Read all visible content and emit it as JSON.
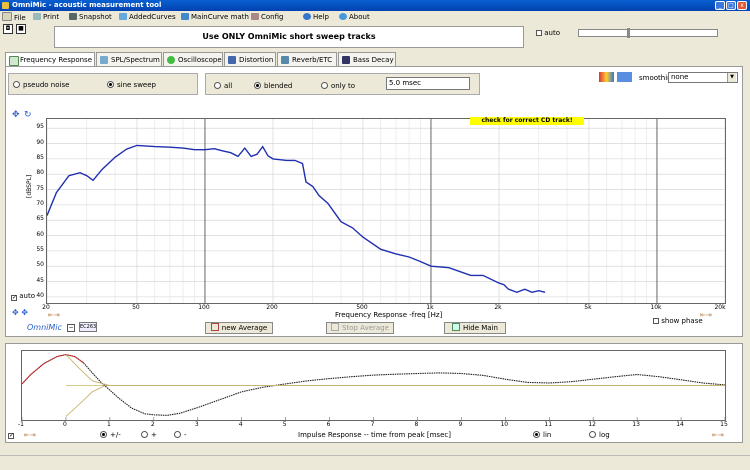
{
  "window": {
    "title": "OmniMic - acoustic measurement tool"
  },
  "menu": [
    {
      "label": "File",
      "icon": "file-icon"
    },
    {
      "label": "Print",
      "icon": "printer-icon"
    },
    {
      "label": "Snapshot",
      "icon": "camera-icon"
    },
    {
      "label": "AddedCurves",
      "icon": "curves-icon"
    },
    {
      "label": "MainCurve math",
      "icon": "math-icon"
    },
    {
      "label": "Config",
      "icon": "wrench-icon"
    },
    {
      "label": "Help",
      "icon": "help-icon"
    },
    {
      "label": "About",
      "icon": "about-icon"
    }
  ],
  "banner": "Use ONLY OmniMic short sweep tracks",
  "auto_label": "auto",
  "tabs": [
    {
      "label": "Frequency Response",
      "active": true
    },
    {
      "label": "SPL/Spectrum"
    },
    {
      "label": "Oscilloscope"
    },
    {
      "label": "Distortion"
    },
    {
      "label": "Reverb/ETC"
    },
    {
      "label": "Bass Decay"
    }
  ],
  "signal": {
    "pseudo_noise": "pseudo noise",
    "sine_sweep": "sine sweep",
    "selected": "sine sweep"
  },
  "window_mode": {
    "all": "all",
    "blended": "blended",
    "only_to": "only to",
    "value": "5.0 msec",
    "selected": "blended"
  },
  "smoothing": {
    "label": "smoothing",
    "value": "none"
  },
  "cd_note": "check for correct CD track!",
  "chart": {
    "ylabel": "[dBSPL]",
    "xlabel": "Frequency Response -freq [Hz]",
    "yticks": [
      "95",
      "90",
      "85",
      "80",
      "75",
      "70",
      "65",
      "60",
      "55",
      "50",
      "45",
      "40"
    ],
    "xticks": [
      {
        "label": "20",
        "f": 20
      },
      {
        "label": "50",
        "f": 50
      },
      {
        "label": "100",
        "f": 100
      },
      {
        "label": "200",
        "f": 200
      },
      {
        "label": "500",
        "f": 500
      },
      {
        "label": "1k",
        "f": 1000
      },
      {
        "label": "2k",
        "f": 2000
      },
      {
        "label": "5k",
        "f": 5000
      },
      {
        "label": "10k",
        "f": 10000
      },
      {
        "label": "20k",
        "f": 20000
      }
    ],
    "auto_label": "auto",
    "show_phase": "show phase",
    "mic_label": "OmniMic",
    "mic_id": "EC263",
    "buttons": {
      "new_average": "new Average",
      "stop_average": "Stop Average",
      "hide_main": "Hide Main"
    },
    "series_color": "#1f2fb0"
  },
  "chart_data": [
    {
      "type": "line",
      "title": "",
      "xlabel": "Frequency Response -freq [Hz]",
      "ylabel": "[dBSPL]",
      "xscale": "log",
      "xlim": [
        20,
        20000
      ],
      "ylim": [
        38,
        98
      ],
      "grid": true,
      "x": [
        20,
        22,
        25,
        28,
        30,
        32,
        35,
        40,
        45,
        50,
        60,
        70,
        80,
        90,
        100,
        110,
        120,
        130,
        140,
        150,
        160,
        170,
        180,
        190,
        200,
        230,
        250,
        270,
        280,
        300,
        320,
        350,
        400,
        450,
        500,
        600,
        700,
        800,
        900,
        1000,
        1200,
        1500,
        1700,
        2000,
        2100,
        2200,
        2400,
        2600,
        2800,
        3000,
        3200
      ],
      "y": [
        66.5,
        74,
        79.5,
        80.5,
        79.5,
        78,
        81.5,
        85.5,
        88.2,
        89.4,
        89,
        88.8,
        88.5,
        88,
        88,
        88.3,
        87.6,
        87,
        85.8,
        88.5,
        85.8,
        86.5,
        89,
        86,
        85,
        84.5,
        84.5,
        83.5,
        77.5,
        76,
        73,
        70.5,
        64.5,
        62.5,
        59.5,
        55.5,
        54,
        53,
        51.5,
        50,
        49.5,
        47,
        47,
        44.5,
        44,
        42.5,
        41.5,
        42.5,
        41.5,
        42,
        41.5
      ]
    },
    {
      "type": "line",
      "title": "",
      "xlabel": "Impulse Response  -- time from peak [msec]",
      "xlim": [
        -1,
        15
      ],
      "ylim": [
        -1,
        1
      ],
      "series": [
        {
          "color": "#222222",
          "x": [
            -1,
            -0.8,
            -0.5,
            -0.2,
            0,
            0.2,
            0.4,
            0.6,
            0.8,
            1,
            1.2,
            1.5,
            1.8,
            2,
            2.3,
            2.6,
            3,
            3.5,
            4,
            4.5,
            5,
            5.5,
            6,
            6.5,
            7,
            7.5,
            8,
            8.5,
            9,
            9.5,
            10,
            10.5,
            11,
            11.5,
            12,
            12.5,
            13,
            13.5,
            14,
            14.5,
            15
          ],
          "y": [
            0.05,
            0.35,
            0.7,
            0.92,
            0.98,
            0.92,
            0.72,
            0.4,
            0.1,
            -0.15,
            -0.4,
            -0.72,
            -0.9,
            -0.93,
            -0.95,
            -0.88,
            -0.7,
            -0.45,
            -0.2,
            -0.05,
            0.05,
            0.15,
            0.22,
            0.28,
            0.33,
            0.36,
            0.38,
            0.4,
            0.38,
            0.32,
            0.2,
            0.1,
            0.08,
            0.12,
            0.2,
            0.28,
            0.35,
            0.28,
            0.18,
            0.08,
            0.02
          ]
        },
        {
          "color": "#cc2222",
          "x": [
            -1,
            -0.8,
            -0.5,
            -0.2,
            0,
            0.2,
            0.4
          ],
          "y": [
            0.05,
            0.35,
            0.7,
            0.92,
            0.98,
            0.92,
            0.72
          ]
        },
        {
          "color": "#c8b46a",
          "x": [
            0,
            0.3,
            0.6,
            1,
            1.5,
            2,
            3,
            5,
            10,
            15
          ],
          "y": [
            0.98,
            0.55,
            0.15,
            0,
            0,
            0,
            0,
            0,
            0,
            0
          ]
        },
        {
          "color": "#c8b46a",
          "x": [
            0,
            0.3,
            0.6,
            0.9,
            1.2,
            1.5
          ],
          "y": [
            -0.98,
            -0.6,
            -0.2,
            0,
            0,
            0
          ]
        }
      ]
    }
  ],
  "impulse": {
    "xlabel": "Impulse Response  -- time from peak [msec]",
    "xticks": [
      "-1",
      "0",
      "1",
      "2",
      "3",
      "4",
      "5",
      "6",
      "7",
      "8",
      "9",
      "10",
      "11",
      "12",
      "13",
      "14",
      "15"
    ],
    "pol": {
      "pm": "+/-",
      "plus": "+",
      "minus": "-",
      "selected": "+/-"
    },
    "scale": {
      "lin": "lin",
      "log": "log",
      "selected": "lin"
    }
  },
  "colors": {
    "accent": "#0a5fd0",
    "title_bar": "#0042b0",
    "highlight": "#ffff00"
  }
}
